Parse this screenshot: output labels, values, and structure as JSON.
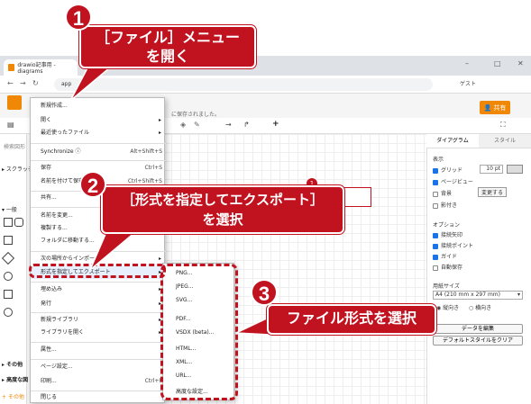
{
  "browser": {
    "tab_title": "drawio記事用 - diagrams",
    "address": "app",
    "window_controls": [
      "–",
      "□",
      "✕"
    ],
    "guest_label": "ゲスト"
  },
  "app": {
    "saved_message": "に保存されました。",
    "share_button": "共有",
    "left_panel": {
      "search_placeholder": "検索図形",
      "scratchpad": "スクラッチ",
      "general": "一般",
      "other": "その他",
      "advanced": "高度な図",
      "more_shapes": "その他"
    },
    "canvas_badge": "1"
  },
  "right_panel": {
    "tabs": [
      "ダイアグラム",
      "スタイル"
    ],
    "view_heading": "表示",
    "grid_label": "グリッド",
    "grid_size": "10 pt",
    "page_view_label": "ページビュー",
    "background_label": "背景",
    "shadow_label": "影付き",
    "change_button": "変更する",
    "options_heading": "オプション",
    "connection_arrows": "接続矢印",
    "connection_points": "接続ポイント",
    "guides": "ガイド",
    "autosave": "自動保存",
    "paper_size_heading": "用紙サイズ",
    "paper_size_value": "A4 (210 mm x 297 mm)",
    "portrait": "縦向き",
    "landscape": "横向き",
    "edit_data_button": "データを編集",
    "clear_default_style_button": "デフォルトスタイルをクリア"
  },
  "file_menu": {
    "items": [
      {
        "label": "新規作成...",
        "shortcut": ""
      },
      {
        "label": "開く",
        "shortcut": "",
        "arrow": "▸"
      },
      {
        "label": "最近使ったファイル",
        "shortcut": "",
        "arrow": "▸"
      },
      {
        "label": "Synchronize",
        "shortcut": "Alt+Shift+S"
      },
      {
        "label": "保存",
        "shortcut": "Ctrl+S"
      },
      {
        "label": "名前を付けて保存...",
        "shortcut": "Ctrl+Shift+S"
      },
      {
        "label": "共有...",
        "shortcut": ""
      },
      {
        "label": "名前を変更...",
        "shortcut": ""
      },
      {
        "label": "複製する...",
        "shortcut": ""
      },
      {
        "label": "フォルダに移動する...",
        "shortcut": ""
      },
      {
        "label": "次の場所からインポート",
        "shortcut": "",
        "arrow": "▸"
      },
      {
        "label": "形式を指定してエクスポート",
        "shortcut": "",
        "arrow": "▸"
      },
      {
        "label": "埋め込み",
        "shortcut": "",
        "arrow": "▸"
      },
      {
        "label": "発行",
        "shortcut": "",
        "arrow": "▸"
      },
      {
        "label": "新規ライブラリ",
        "shortcut": "",
        "arrow": "▸"
      },
      {
        "label": "ライブラリを開く",
        "shortcut": "",
        "arrow": "▸"
      },
      {
        "label": "属性...",
        "shortcut": ""
      },
      {
        "label": "ページ設定...",
        "shortcut": ""
      },
      {
        "label": "印刷...",
        "shortcut": "Ctrl+P"
      },
      {
        "label": "閉じる",
        "shortcut": ""
      }
    ]
  },
  "export_submenu": {
    "items": [
      "PNG...",
      "JPEG...",
      "SVG...",
      "PDF...",
      "VSDX (beta)...",
      "HTML...",
      "XML...",
      "URL...",
      "高度な設定..."
    ]
  },
  "callouts": {
    "step1_number": "1",
    "step1_text": "［ファイル］メニュー\nを開く",
    "step2_number": "2",
    "step2_text": "［形式を指定してエクスポート］\nを選択",
    "step3_number": "3",
    "step3_text": "ファイル形式を選択"
  },
  "colors": {
    "callout_red": "#c1121f",
    "drawio_orange": "#f08705",
    "checkbox_blue": "#1a73e8"
  }
}
